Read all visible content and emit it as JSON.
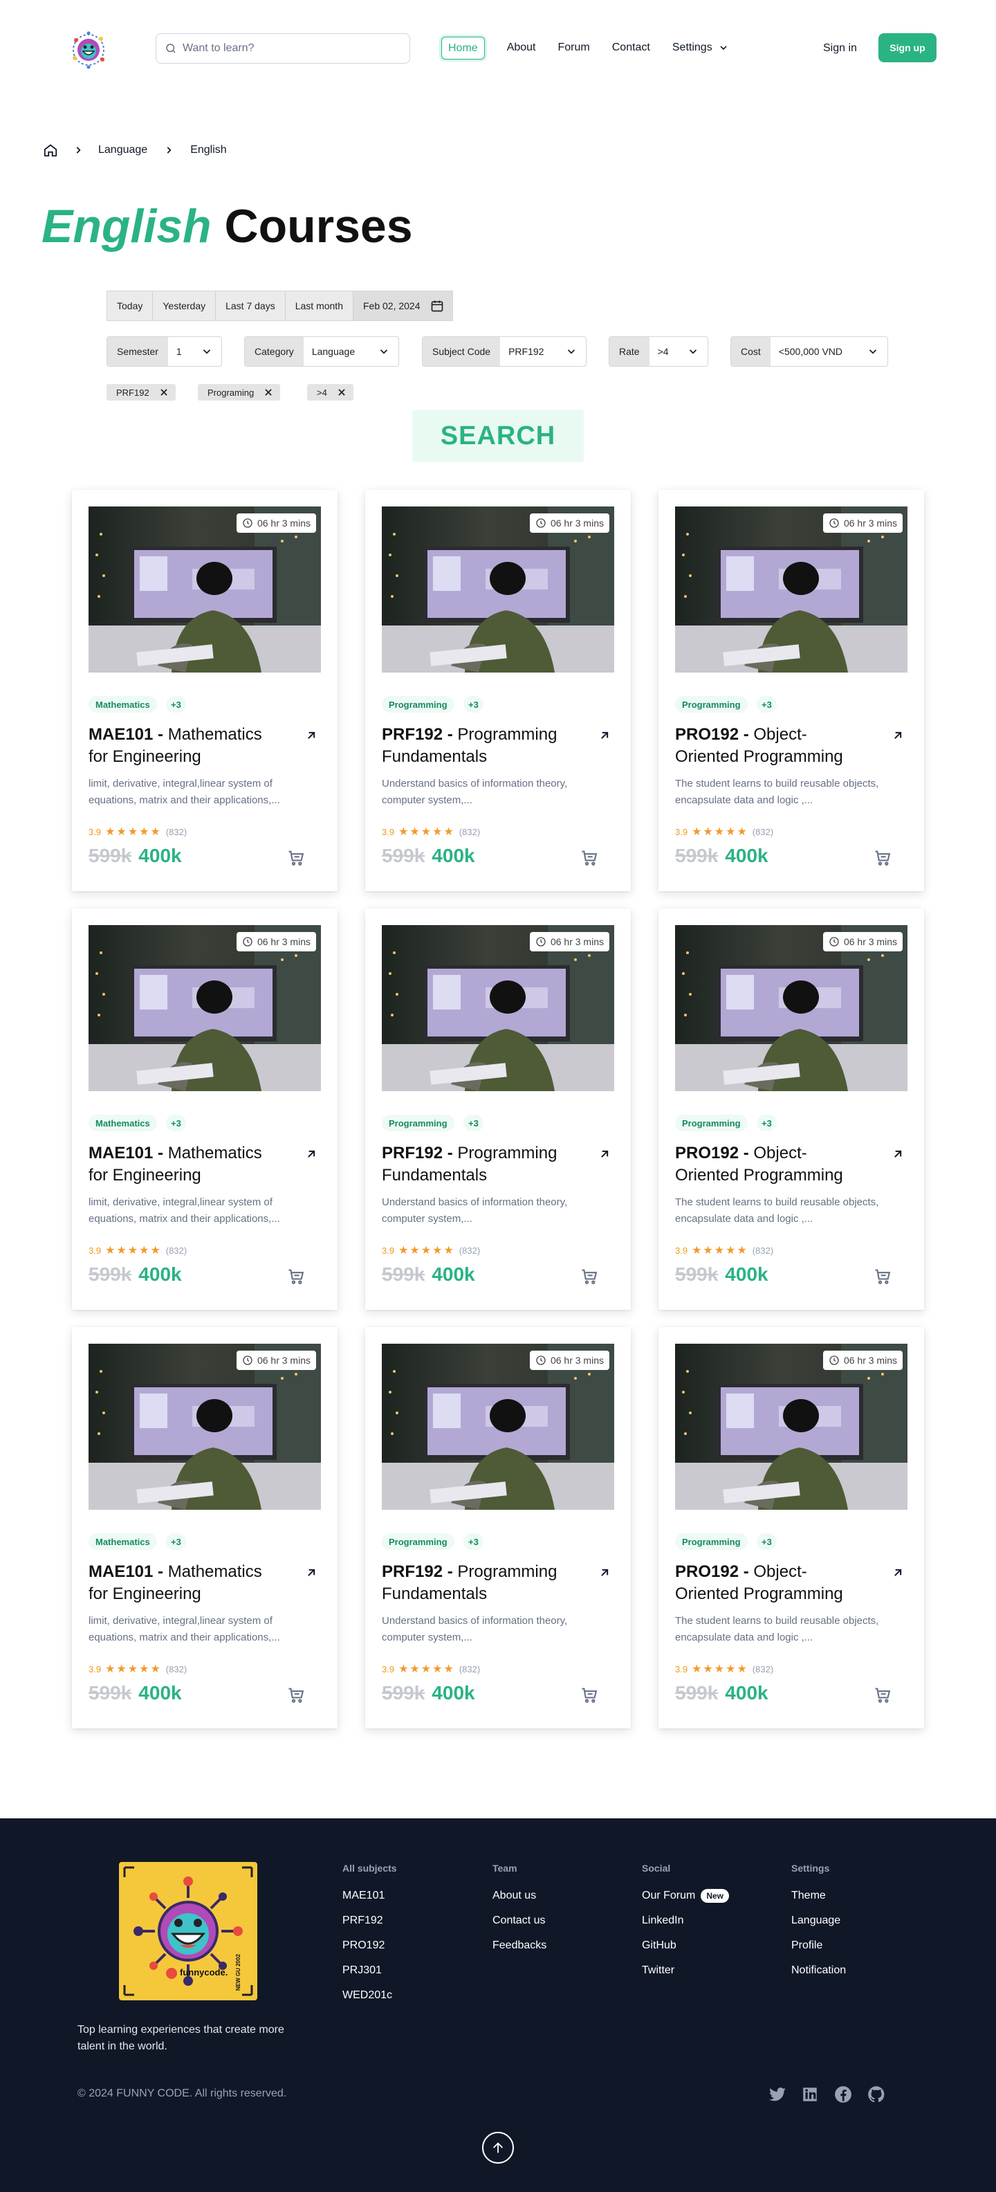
{
  "search": {
    "placeholder": "Want to learn?"
  },
  "nav": {
    "home": "Home",
    "about": "About",
    "forum": "Forum",
    "contact": "Contact",
    "settings": "Settings"
  },
  "auth": {
    "sign_in": "Sign in",
    "sign_up": "Sign up"
  },
  "breadcrumb": {
    "items": [
      "Language",
      "English"
    ]
  },
  "page_title": {
    "highlight": "English",
    "rest": " Courses"
  },
  "date_filters": {
    "buttons": [
      "Today",
      "Yesterday",
      "Last 7 days",
      "Last month"
    ],
    "picker": "Feb 02, 2024"
  },
  "filters": [
    {
      "label": "Semester",
      "value": "1"
    },
    {
      "label": "Category",
      "value": "Language"
    },
    {
      "label": "Subject Code",
      "value": "PRF192"
    },
    {
      "label": "Rate",
      "value": ">4"
    },
    {
      "label": "Cost",
      "value": "<500,000 VND"
    }
  ],
  "active_filters": [
    "PRF192",
    "Programing",
    ">4"
  ],
  "search_button": "SEARCH",
  "courses": [
    {
      "duration": "06 hr 3 mins",
      "tag": "Mathematics",
      "more": "+3",
      "code": "MAE101",
      "sep": " - ",
      "name": "Mathematics for Engineering",
      "desc": "limit, derivative, integral,linear system of equations, matrix and their applications,...",
      "rating": "3.9",
      "stars": "★★★★★",
      "count": "(832)",
      "old_price": "599k",
      "price": "400k"
    },
    {
      "duration": "06 hr 3 mins",
      "tag": "Programming",
      "more": "+3",
      "code": "PRF192",
      "sep": " - ",
      "name": "Programming Fundamentals",
      "desc": "Understand basics of information theory, computer system,...",
      "rating": "3.9",
      "stars": "★★★★★",
      "count": "(832)",
      "old_price": "599k",
      "price": "400k"
    },
    {
      "duration": "06 hr 3 mins",
      "tag": "Programming",
      "more": "+3",
      "code": "PRO192",
      "sep": " - ",
      "name": "Object-Oriented Programming",
      "desc": "The student learns to build reusable objects, encapsulate data and logic ,...",
      "rating": "3.9",
      "stars": "★★★★★",
      "count": "(832)",
      "old_price": "599k",
      "price": "400k"
    },
    {
      "duration": "06 hr 3 mins",
      "tag": "Mathematics",
      "more": "+3",
      "code": "MAE101",
      "sep": " - ",
      "name": "Mathematics for Engineering",
      "desc": "limit, derivative, integral,linear system of equations, matrix and their applications,...",
      "rating": "3.9",
      "stars": "★★★★★",
      "count": "(832)",
      "old_price": "599k",
      "price": "400k"
    },
    {
      "duration": "06 hr 3 mins",
      "tag": "Programming",
      "more": "+3",
      "code": "PRF192",
      "sep": " - ",
      "name": "Programming Fundamentals",
      "desc": "Understand basics of information theory, computer system,...",
      "rating": "3.9",
      "stars": "★★★★★",
      "count": "(832)",
      "old_price": "599k",
      "price": "400k"
    },
    {
      "duration": "06 hr 3 mins",
      "tag": "Programming",
      "more": "+3",
      "code": "PRO192",
      "sep": " - ",
      "name": "Object-Oriented Programming",
      "desc": "The student learns to build reusable objects, encapsulate data and logic ,...",
      "rating": "3.9",
      "stars": "★★★★★",
      "count": "(832)",
      "old_price": "599k",
      "price": "400k"
    },
    {
      "duration": "06 hr 3 mins",
      "tag": "Mathematics",
      "more": "+3",
      "code": "MAE101",
      "sep": " - ",
      "name": "Mathematics for Engineering",
      "desc": "limit, derivative, integral,linear system of equations, matrix and their applications,...",
      "rating": "3.9",
      "stars": "★★★★★",
      "count": "(832)",
      "old_price": "599k",
      "price": "400k"
    },
    {
      "duration": "06 hr 3 mins",
      "tag": "Programming",
      "more": "+3",
      "code": "PRF192",
      "sep": " - ",
      "name": "Programming Fundamentals",
      "desc": "Understand basics of information theory, computer system,...",
      "rating": "3.9",
      "stars": "★★★★★",
      "count": "(832)",
      "old_price": "599k",
      "price": "400k"
    },
    {
      "duration": "06 hr 3 mins",
      "tag": "Programming",
      "more": "+3",
      "code": "PRO192",
      "sep": " - ",
      "name": "Object-Oriented Programming",
      "desc": "The student learns to build reusable objects, encapsulate data and logic ,...",
      "rating": "3.9",
      "stars": "★★★★★",
      "count": "(832)",
      "old_price": "599k",
      "price": "400k"
    }
  ],
  "footer": {
    "badge_text": "funnycode.",
    "badge_side": "NEW GU 2002",
    "tagline": "Top learning experiences that create more talent in the world.",
    "columns": [
      {
        "title": "All subjects",
        "links": [
          "MAE101",
          "PRF192",
          "PRO192",
          "PRJ301",
          "WED201c"
        ]
      },
      {
        "title": "Team",
        "links": [
          "About us",
          "Contact us",
          "Feedbacks"
        ]
      },
      {
        "title": "Social",
        "links": [
          "Our Forum",
          "LinkedIn",
          "GitHub",
          "Twitter"
        ],
        "badge": "New"
      },
      {
        "title": "Settings",
        "links": [
          "Theme",
          "Language",
          "Profile",
          "Notification"
        ]
      }
    ],
    "copyright": "© 2024 FUNNY CODE. All rights reserved.",
    "social_icons": [
      "twitter-icon",
      "linkedin-icon",
      "facebook-icon",
      "github-icon"
    ]
  },
  "colors": {
    "brand": "#2ab383",
    "footer_bg": "#101828",
    "star": "#f29a2e"
  }
}
